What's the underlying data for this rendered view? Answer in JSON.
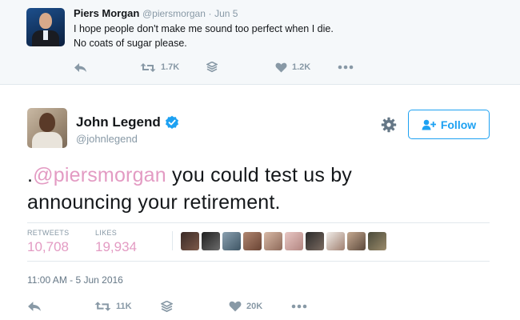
{
  "parent_tweet": {
    "name": "Piers Morgan",
    "handle": "@piersmorgan",
    "separator": "·",
    "date": "Jun 5",
    "text_lines": [
      "I hope people don't make me sound too perfect when I die.",
      "No coats of sugar please."
    ],
    "retweets": "1.7K",
    "likes": "1.2K",
    "icons": {
      "reply": "reply-icon",
      "retweet": "retweet-icon",
      "stack": "stack-icon",
      "like": "heart-icon",
      "more": "more-icon"
    }
  },
  "main_tweet": {
    "name": "John Legend",
    "verified": true,
    "handle": "@johnlegend",
    "follow_label": "Follow",
    "text": {
      "prefix": ".",
      "mention": "@piersmorgan",
      "rest_line1": " you could test us by",
      "line2": "announcing your retirement."
    },
    "stats": {
      "retweets_label": "RETWEETS",
      "retweets_value": "10,708",
      "likes_label": "LIKES",
      "likes_value": "19,934"
    },
    "likers_count_shown": 10,
    "timestamp": "11:00 AM - 5 Jun 2016",
    "retweets_short": "11K",
    "likes_short": "20K"
  },
  "colors": {
    "accent": "#1da1f2",
    "mention_pink": "#e39bc3",
    "muted": "#8899a6",
    "parent_bg": "#f5f8fa"
  }
}
